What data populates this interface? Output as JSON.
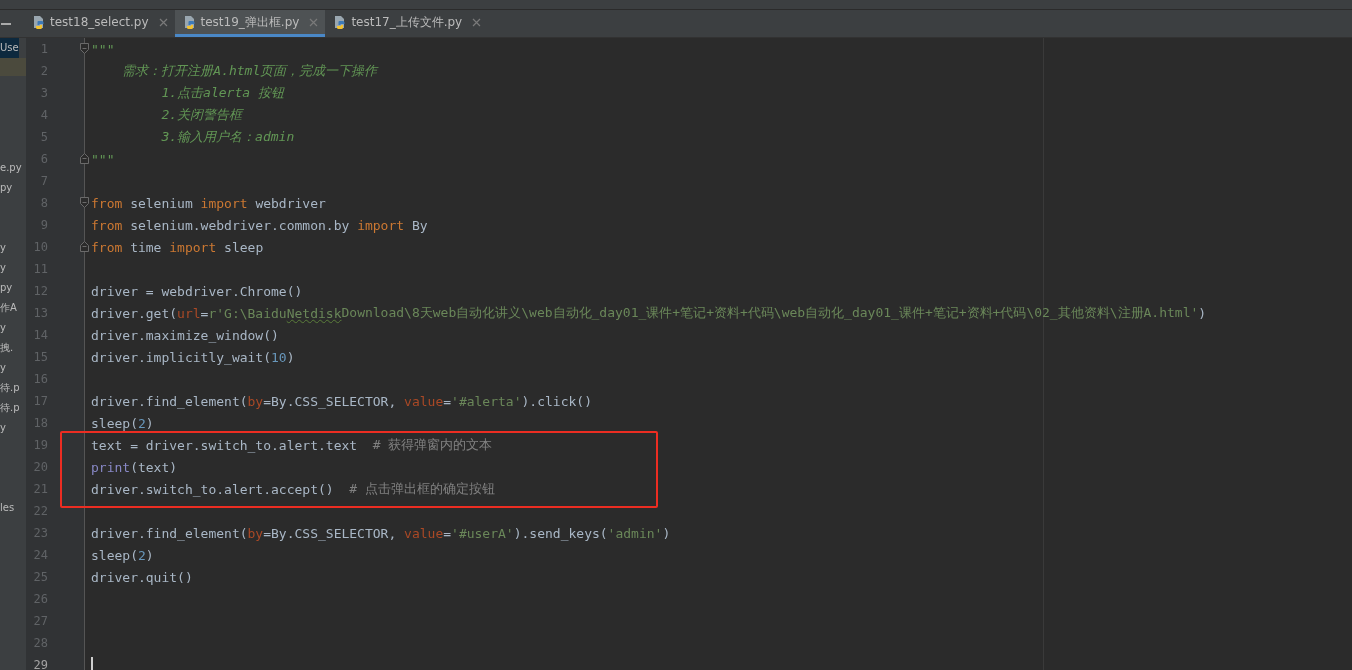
{
  "sidebar": {
    "top_item": {
      "text": "Use",
      "selected": true
    },
    "groups": [
      [
        {
          "text": "e.py",
          "selected": false
        },
        {
          "text": "py",
          "selected": false
        }
      ],
      [
        {
          "text": "y",
          "selected": false
        },
        {
          "text": "y",
          "selected": false
        },
        {
          "text": "py",
          "selected": false
        },
        {
          "text": "作A",
          "selected": false
        },
        {
          "text": "y",
          "selected": false
        },
        {
          "text": "拽.",
          "selected": false
        },
        {
          "text": "y",
          "selected": false
        },
        {
          "text": "待.p",
          "selected": false
        },
        {
          "text": "待.p",
          "selected": false
        },
        {
          "text": "y",
          "selected": false
        }
      ],
      [
        {
          "text": "les",
          "selected": false
        }
      ]
    ]
  },
  "tabs": [
    {
      "label": "test18_select.py",
      "selected": false
    },
    {
      "label": "test19_弹出框.py",
      "selected": true
    },
    {
      "label": "test17_上传文件.py",
      "selected": false
    }
  ],
  "editor": {
    "blocks": [
      {
        "boxed": false,
        "lines": [
          {
            "number": "1",
            "kind": "fold_start",
            "tokens": [
              {
                "kind": "doc",
                "text": "\"\"\""
              }
            ]
          },
          {
            "number": "2",
            "kind": "plain",
            "tokens": [
              {
                "kind": "doc",
                "text": "    需求：打开注册A.html页面，完成一下操作"
              }
            ]
          },
          {
            "number": "3",
            "kind": "plain",
            "tokens": [
              {
                "kind": "doc",
                "text": "         1.点击alerta 按钮"
              }
            ]
          },
          {
            "number": "4",
            "kind": "plain",
            "tokens": [
              {
                "kind": "doc",
                "text": "         2.关闭警告框"
              }
            ]
          },
          {
            "number": "5",
            "kind": "plain",
            "tokens": [
              {
                "kind": "doc",
                "text": "         3.输入用户名：admin"
              }
            ]
          },
          {
            "number": "6",
            "kind": "fold_end",
            "tokens": [
              {
                "kind": "doc",
                "text": "\"\"\""
              }
            ]
          },
          {
            "number": "7",
            "kind": "plain"
          },
          {
            "number": "8",
            "kind": "fold_start",
            "tokens": [
              {
                "kind": "kw",
                "text": "from"
              },
              {
                "kind": "id",
                "text": " selenium "
              },
              {
                "kind": "kw",
                "text": "import"
              },
              {
                "kind": "id",
                "text": " webdriver"
              }
            ]
          },
          {
            "number": "9",
            "kind": "plain",
            "tokens": [
              {
                "kind": "kw",
                "text": "from"
              },
              {
                "kind": "id",
                "text": " selenium.webdriver.common.by "
              },
              {
                "kind": "kw",
                "text": "import"
              },
              {
                "kind": "id",
                "text": " By"
              }
            ]
          },
          {
            "number": "10",
            "kind": "fold_end",
            "tokens": [
              {
                "kind": "kw",
                "text": "from"
              },
              {
                "kind": "id",
                "text": " time "
              },
              {
                "kind": "kw",
                "text": "import"
              },
              {
                "kind": "id",
                "text": " sleep"
              }
            ]
          },
          {
            "number": "11",
            "kind": "plain"
          },
          {
            "number": "12",
            "kind": "plain",
            "tokens": [
              {
                "kind": "id",
                "text": "driver = webdriver.Chrome()"
              }
            ]
          },
          {
            "number": "13",
            "kind": "plain",
            "tokens": [
              {
                "kind": "id",
                "text": "driver.get("
              },
              {
                "kind": "param",
                "text": "url"
              },
              {
                "kind": "id",
                "text": "="
              },
              {
                "kind": "str",
                "text": "r'G:\\Baidu"
              },
              {
                "kind": "typo",
                "text": "Netdisk"
              },
              {
                "kind": "str",
                "text": "Download\\8天web自动化讲义\\web自动化_day01_课件+笔记+资料+代码\\web自动化_day01_课件+笔记+资料+代码\\02_其他资料\\注册A.html'"
              },
              {
                "kind": "id",
                "text": ")"
              }
            ]
          },
          {
            "number": "14",
            "kind": "plain",
            "tokens": [
              {
                "kind": "id",
                "text": "driver.maximize_window()"
              }
            ]
          },
          {
            "number": "15",
            "kind": "plain",
            "tokens": [
              {
                "kind": "id",
                "text": "driver.implicitly_wait("
              },
              {
                "kind": "num",
                "text": "10"
              },
              {
                "kind": "id",
                "text": ")"
              }
            ]
          },
          {
            "number": "16",
            "kind": "plain"
          },
          {
            "number": "17",
            "kind": "plain",
            "tokens": [
              {
                "kind": "id",
                "text": "driver.find_element("
              },
              {
                "kind": "param",
                "text": "by"
              },
              {
                "kind": "id",
                "text": "=By.CSS_SELECTOR, "
              },
              {
                "kind": "param",
                "text": "value"
              },
              {
                "kind": "id",
                "text": "="
              },
              {
                "kind": "str",
                "text": "'#alerta'"
              },
              {
                "kind": "id",
                "text": ").click()"
              }
            ]
          },
          {
            "number": "18",
            "kind": "plain",
            "tokens": [
              {
                "kind": "id",
                "text": "sleep("
              },
              {
                "kind": "num",
                "text": "2"
              },
              {
                "kind": "id",
                "text": ")"
              }
            ]
          }
        ]
      },
      {
        "boxed": true,
        "lines": [
          {
            "number": "19",
            "kind": "plain",
            "tokens": [
              {
                "kind": "id",
                "text": "text = driver.switch_to.alert.text  "
              },
              {
                "kind": "comment",
                "text": "# 获得弹窗内的文本"
              }
            ]
          },
          {
            "number": "20",
            "kind": "plain",
            "tokens": [
              {
                "kind": "builtin",
                "text": "print"
              },
              {
                "kind": "id",
                "text": "(text)"
              }
            ]
          },
          {
            "number": "21",
            "kind": "plain",
            "tokens": [
              {
                "kind": "id",
                "text": "driver.switch_to.alert.accept()  "
              },
              {
                "kind": "comment",
                "text": "# 点击弹出框的确定按钮"
              }
            ]
          }
        ]
      },
      {
        "boxed": false,
        "lines": [
          {
            "number": "22",
            "kind": "plain"
          },
          {
            "number": "23",
            "kind": "plain",
            "tokens": [
              {
                "kind": "id",
                "text": "driver.find_element("
              },
              {
                "kind": "param",
                "text": "by"
              },
              {
                "kind": "id",
                "text": "=By.CSS_SELECTOR, "
              },
              {
                "kind": "param",
                "text": "value"
              },
              {
                "kind": "id",
                "text": "="
              },
              {
                "kind": "str",
                "text": "'#userA'"
              },
              {
                "kind": "id",
                "text": ").send_keys("
              },
              {
                "kind": "str",
                "text": "'admin'"
              },
              {
                "kind": "id",
                "text": ")"
              }
            ]
          },
          {
            "number": "24",
            "kind": "plain",
            "tokens": [
              {
                "kind": "id",
                "text": "sleep("
              },
              {
                "kind": "num",
                "text": "2"
              },
              {
                "kind": "id",
                "text": ")"
              }
            ]
          },
          {
            "number": "25",
            "kind": "plain",
            "tokens": [
              {
                "kind": "id",
                "text": "driver.quit()"
              }
            ]
          },
          {
            "number": "26",
            "kind": "plain"
          },
          {
            "number": "27",
            "kind": "plain"
          },
          {
            "number": "28",
            "kind": "plain"
          },
          {
            "number": "29",
            "kind": "plain",
            "current": true
          }
        ]
      }
    ]
  }
}
